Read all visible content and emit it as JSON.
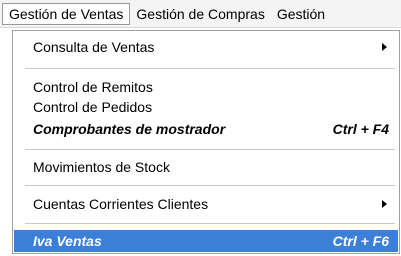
{
  "menubar": {
    "items": [
      {
        "label": "Gestión de Ventas",
        "open": true
      },
      {
        "label": "Gestión de Compras"
      },
      {
        "label": "Gestión"
      }
    ]
  },
  "menu": {
    "consulta_ventas": "Consulta de Ventas",
    "control_remitos": "Control de Remitos",
    "control_pedidos": "Control de Pedidos",
    "comprobantes_mostrador": "Comprobantes de mostrador",
    "comprobantes_shortcut": "Ctrl + F4",
    "movimientos_stock": "Movimientos de Stock",
    "cuentas_corrientes": "Cuentas Corrientes Clientes",
    "iva_ventas": "Iva Ventas",
    "iva_shortcut": "Ctrl + F6"
  },
  "colors": {
    "highlight": "#3b7fd6",
    "menubar_bg": "#f4f4f4"
  }
}
